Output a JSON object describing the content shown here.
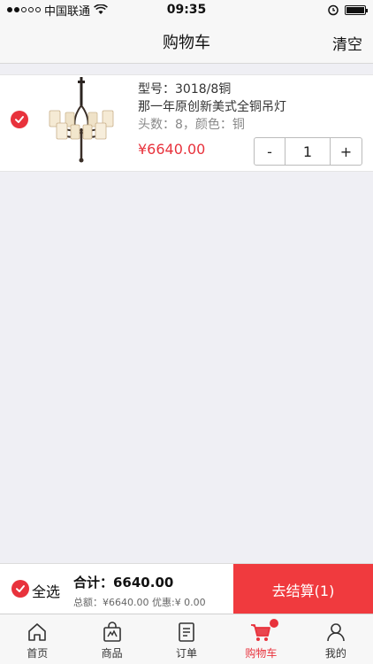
{
  "status_bar": {
    "carrier": "中国联通",
    "time": "09:35"
  },
  "nav": {
    "title": "购物车",
    "clear_label": "清空"
  },
  "cart_item": {
    "model": "型号：3018/8铜",
    "name": "那一年原创新美式全铜吊灯",
    "spec": "头数：8，颜色：铜",
    "price": "¥6640.00",
    "quantity": "1",
    "minus_label": "-",
    "plus_label": "+",
    "image_icon": "chandelier-image",
    "checked": true
  },
  "summary": {
    "select_all_label": "全选",
    "total_label": "合计：6640.00",
    "subtotal_text": "总额：¥6640.00 优惠:¥ 0.00",
    "checkout_label": "去结算(1)"
  },
  "tabs": [
    {
      "label": "首页",
      "icon": "home-icon",
      "active": false
    },
    {
      "label": "商品",
      "icon": "shopping-bag-icon",
      "active": false
    },
    {
      "label": "订单",
      "icon": "order-list-icon",
      "active": false
    },
    {
      "label": "购物车",
      "icon": "cart-icon",
      "active": true
    },
    {
      "label": "我的",
      "icon": "user-icon",
      "active": false
    }
  ],
  "colors": {
    "accent": "#e8323c",
    "checkout": "#f03a3e",
    "background": "#efeff4"
  }
}
